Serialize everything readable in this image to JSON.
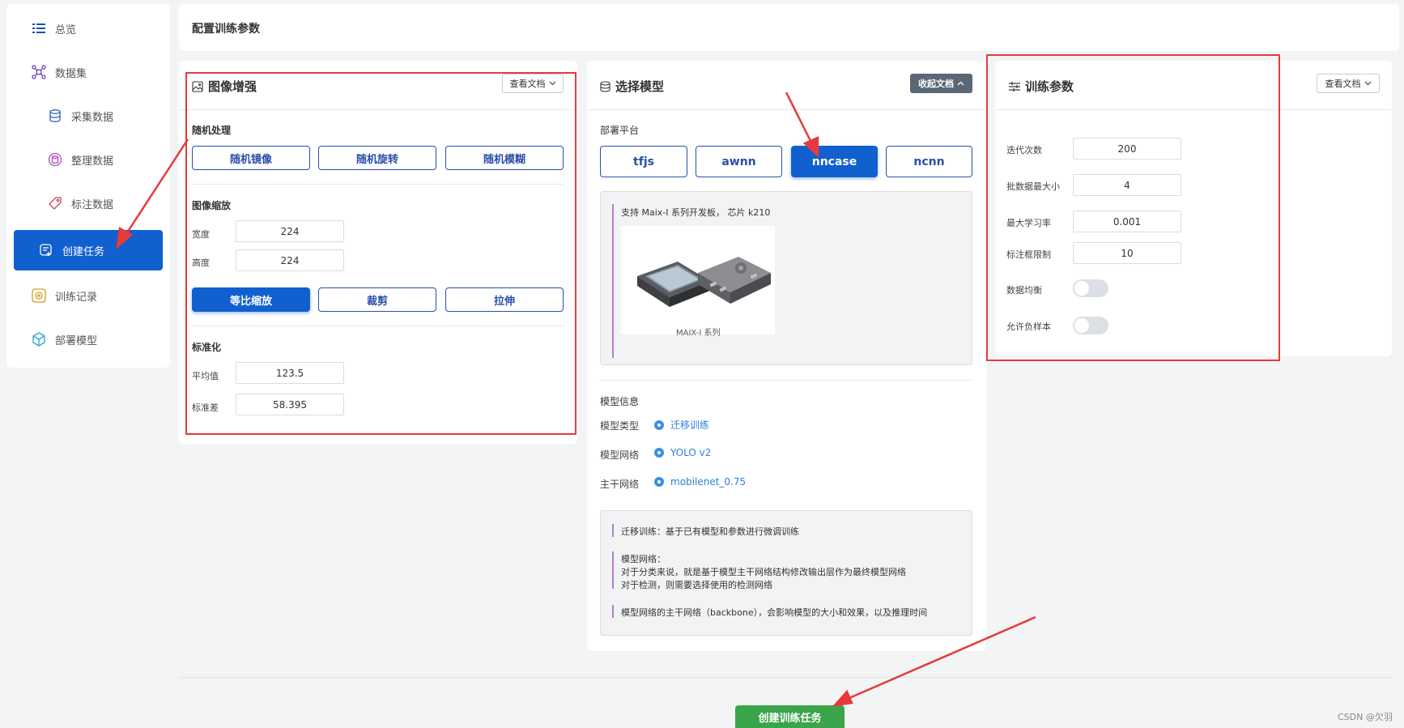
{
  "sidebar": {
    "items": [
      {
        "label": "总览",
        "icon": "list-icon"
      },
      {
        "label": "数据集",
        "icon": "dataset-icon"
      },
      {
        "label": "采集数据",
        "icon": "database-icon"
      },
      {
        "label": "整理数据",
        "icon": "organize-icon"
      },
      {
        "label": "标注数据",
        "icon": "tag-icon"
      },
      {
        "label": "创建任务",
        "icon": "create-task-icon"
      },
      {
        "label": "训练记录",
        "icon": "record-icon"
      },
      {
        "label": "部署模型",
        "icon": "cube-icon"
      }
    ],
    "active_index": 5
  },
  "header": {
    "title": "配置训练参数"
  },
  "augment": {
    "title": "图像增强",
    "doc_btn": "查看文档",
    "random_label": "随机处理",
    "random_buttons": [
      "随机镜像",
      "随机旋转",
      "随机模糊"
    ],
    "resize_label": "图像缩放",
    "width_label": "宽度",
    "width_value": "224",
    "height_label": "高度",
    "height_value": "224",
    "resize_buttons": [
      "等比缩放",
      "裁剪",
      "拉伸"
    ],
    "resize_active": "等比缩放",
    "norm_label": "标准化",
    "mean_label": "平均值",
    "mean_value": "123.5",
    "std_label": "标准差",
    "std_value": "58.395"
  },
  "model": {
    "title": "选择模型",
    "doc_btn": "收起文档",
    "platform_label": "部署平台",
    "platforms": [
      "tfjs",
      "awnn",
      "nncase",
      "ncnn"
    ],
    "active_platform": "nncase",
    "support_text": "支持 Maix-I 系列开发板， 芯片 k210",
    "image_caption": "MAIX-I 系列",
    "info_label": "模型信息",
    "type_label": "模型类型",
    "type_value": "迁移训练",
    "network_label": "模型网络",
    "network_value": "YOLO v2",
    "backbone_label": "主干网络",
    "backbone_value": "mobilenet_0.75",
    "doc_lines": {
      "transfer": "迁移训练：基于已有模型和参数进行微调训练",
      "net_title": "模型网络：",
      "net_line1": "对于分类来说，就是基于模型主干网络结构修改输出层作为最终模型网络",
      "net_line2": "对于检测，则需要选择使用的检测网络",
      "backbone": "模型网络的主干网络（backbone），会影响模型的大小和效果，以及推理时间"
    }
  },
  "train": {
    "title": "训练参数",
    "doc_btn": "查看文档",
    "epochs_label": "迭代次数",
    "epochs_value": "200",
    "batch_label": "批数据最大小",
    "batch_value": "4",
    "lr_label": "最大学习率",
    "lr_value": "0.001",
    "bbox_label": "标注框限制",
    "bbox_value": "10",
    "balance_label": "数据均衡",
    "balance_on": false,
    "negative_label": "允许负样本",
    "negative_on": false
  },
  "footer": {
    "create_button": "创建训练任务",
    "watermark": "CSDN @欠羽"
  },
  "colors": {
    "primary": "#1060d0",
    "annotation_red": "#e83a3a",
    "create_green": "#3aa54a"
  }
}
